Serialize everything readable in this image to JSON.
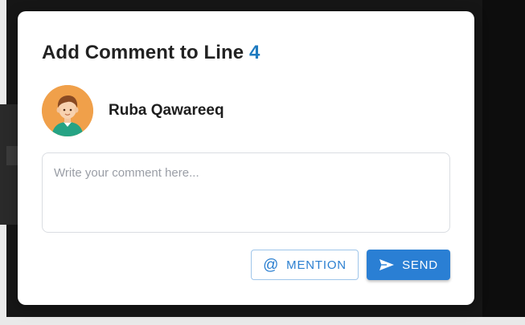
{
  "dialog": {
    "title_prefix": "Add Comment to Line",
    "line_number": "4"
  },
  "user": {
    "name": "Ruba Qawareeq",
    "avatar_icon": "user-avatar-icon"
  },
  "comment": {
    "placeholder": "Write your comment here...",
    "value": ""
  },
  "actions": {
    "mention_label": "MENTION",
    "mention_icon": "at-sign-icon",
    "send_label": "SEND",
    "send_icon": "send-icon"
  },
  "colors": {
    "accent": "#2a7fd4",
    "line_number": "#1f7bc0",
    "avatar_bg": "#f0a04a"
  }
}
